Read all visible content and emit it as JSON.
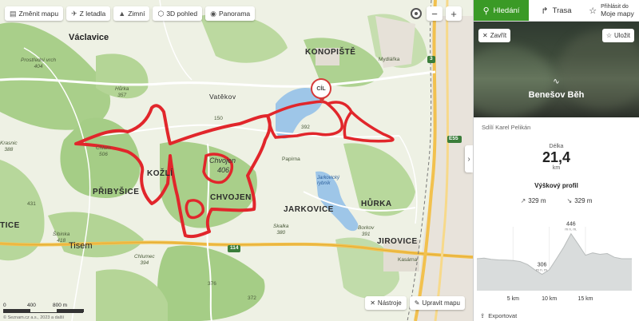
{
  "toolbar": {
    "change_map": "Změnit mapu",
    "from_air": "Z letadla",
    "winter": "Zimní",
    "view_3d": "3D pohled",
    "panorama": "Panorama"
  },
  "zoom": {
    "minus": "−",
    "plus": "+"
  },
  "map_labels": {
    "vaclavice": "Václavice",
    "konopiste": "KONOPIŠTĚ",
    "vatekov": "Vatěkov",
    "kozli": "KOŽLÍ",
    "chvojen": "CHVOJEN",
    "chvojen_hill": "Chvojen",
    "chvojen_num": "406",
    "pribysice": "PŘIBYŠICE",
    "jarkovice": "JARKOVICE",
    "hurka": "HŮRKA",
    "jirovice": "JIROVICE",
    "tisem": "Tisem",
    "tice": "TICE",
    "prostredni_vrch": "Prostřední vrch",
    "prostredni_num": "404",
    "hurka_hill": "Hůrka",
    "hurka_num": "357",
    "chlum": "Chlum",
    "chlum_num": "506",
    "sibinka": "Šibinka",
    "sibinka_num": "418",
    "chlumec": "Chlumec",
    "chlumec_num": "394",
    "skalka": "Skalka",
    "skalka_num": "380",
    "borkov": "Borkov",
    "borkov_num": "391",
    "kasarna": "Kasárna",
    "mydlarka": "Mydlářka",
    "papirna": "Papírna",
    "jarkovicky": "Jarkovický rybník",
    "num_150": "150",
    "num_431": "431",
    "num_376": "376",
    "num_372": "372",
    "num_388": "388",
    "num_392": "392",
    "krasnic": "Krasnic",
    "road_114": "114",
    "road_e55": "E55",
    "road_3": "3",
    "pin_label": "CÍL"
  },
  "scale": {
    "labels": [
      "0",
      "400",
      "800 m"
    ]
  },
  "copyright": "© Seznam.cz a.s., 2023 a další",
  "bottom_tools": {
    "tools": "Nástroje",
    "edit_map": "Upravit mapu"
  },
  "panel": {
    "tabs": {
      "search": "Hledání",
      "route": "Trasa",
      "login_small": "Přihlásit do",
      "login_big": "Moje mapy"
    },
    "close": "Zavřít",
    "save": "Uložit",
    "title": "Benešov Běh",
    "author": "Sdílí Karel Pelikán",
    "distance_label": "Délka",
    "distance_value": "21,4",
    "distance_unit": "km",
    "profile_title": "Výškový profil",
    "ascent": "329 m",
    "descent": "329 m",
    "export": "Exportovat"
  },
  "chart_data": {
    "type": "area",
    "title": "Výškový profil",
    "x": [
      0,
      1,
      2,
      3,
      4,
      5,
      6,
      7,
      8,
      9,
      10,
      11,
      12,
      13,
      14,
      15,
      16,
      17,
      18,
      19,
      20,
      21.4
    ],
    "y": [
      360,
      362,
      358,
      356,
      355,
      354,
      350,
      340,
      322,
      306,
      322,
      360,
      400,
      446,
      410,
      372,
      380,
      375,
      378,
      365,
      360,
      360
    ],
    "xticks": [
      "5 km",
      "10 km",
      "15 km"
    ],
    "xtick_values": [
      5,
      10,
      15
    ],
    "annotations": [
      {
        "x": 9,
        "value": "306",
        "unit": "m n. m."
      },
      {
        "x": 13,
        "value": "446",
        "unit": "m n. m."
      }
    ],
    "ylim": [
      250,
      470
    ],
    "color": "#d9dcdc"
  },
  "colors": {
    "route": "#e1262b",
    "accent": "#3a9a26",
    "water": "#9ec6e8"
  }
}
